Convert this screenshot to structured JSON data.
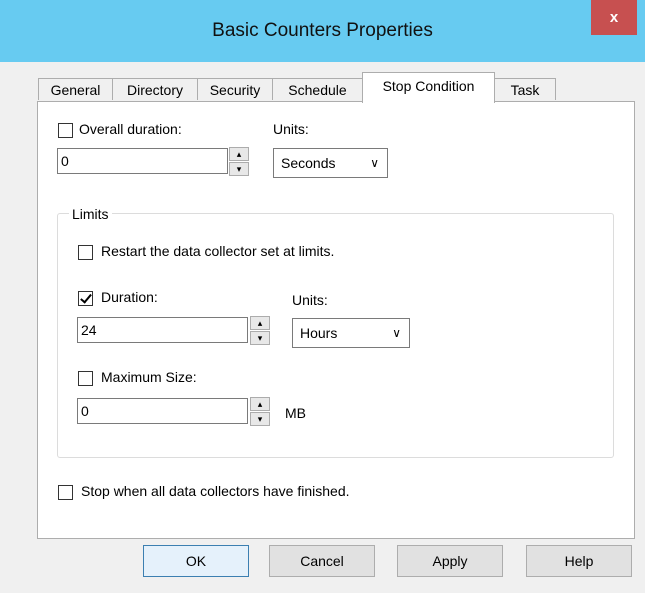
{
  "window": {
    "title": "Basic Counters Properties",
    "close_glyph": "x"
  },
  "tabs": [
    {
      "label": "General",
      "active": false
    },
    {
      "label": "Directory",
      "active": false
    },
    {
      "label": "Security",
      "active": false
    },
    {
      "label": "Schedule",
      "active": false
    },
    {
      "label": "Stop Condition",
      "active": true
    },
    {
      "label": "Task",
      "active": false
    }
  ],
  "overall_duration": {
    "checkbox_label": "Overall duration:",
    "checked": false,
    "value": "0",
    "units_label": "Units:",
    "units_value": "Seconds"
  },
  "limits": {
    "group_label": "Limits",
    "restart_label": "Restart the data collector set at limits.",
    "restart_checked": false,
    "duration_label": "Duration:",
    "duration_checked": true,
    "duration_value": "24",
    "duration_units_label": "Units:",
    "duration_units_value": "Hours",
    "max_size_label": "Maximum Size:",
    "max_size_checked": false,
    "max_size_value": "0",
    "max_size_unit": "MB"
  },
  "stop_when_label": "Stop when all data collectors have finished.",
  "stop_when_checked": false,
  "buttons": {
    "ok": "OK",
    "cancel": "Cancel",
    "apply": "Apply",
    "help": "Help"
  },
  "icons": {
    "spin_up": "▴",
    "spin_down": "▾",
    "dropdown": "∨"
  }
}
